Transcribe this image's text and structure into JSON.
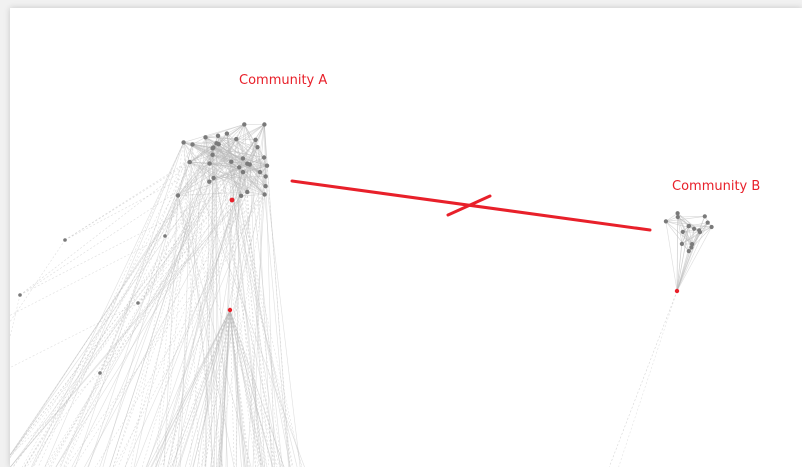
{
  "labels": {
    "community_a": "Community A",
    "community_b": "Community B"
  },
  "colors": {
    "highlight": "#e8202a",
    "node": "#7a7a7a",
    "edge": "#b9b9b9",
    "background": "#ffffff"
  },
  "diagram": {
    "type": "network-graph",
    "communities": [
      "community_a",
      "community_b"
    ],
    "severed_link": {
      "from": "community_a",
      "to": "community_b",
      "marked_cut": true
    }
  }
}
